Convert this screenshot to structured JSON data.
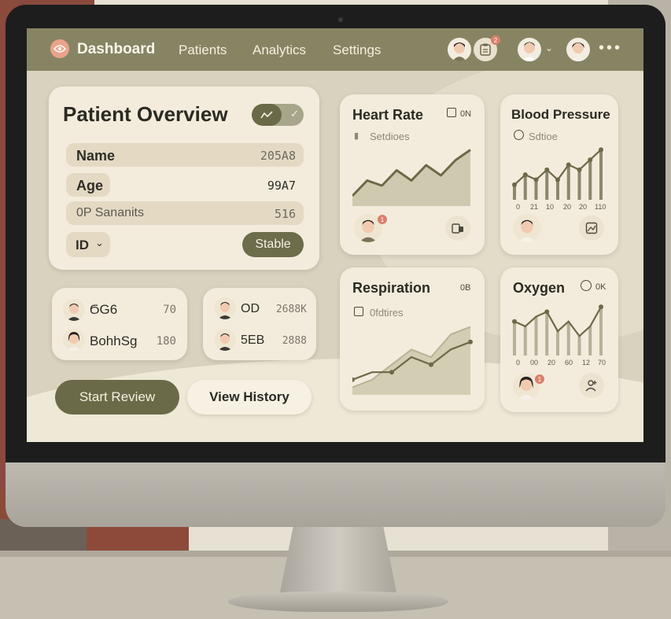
{
  "nav": {
    "brand": "Dashboard",
    "items": [
      "Patients",
      "Analytics",
      "Settings"
    ],
    "notif_count": "2"
  },
  "overview": {
    "title": "Patient Overview",
    "rows": [
      {
        "label": "Name",
        "value": "205A8"
      },
      {
        "label": "Age",
        "value": "99A7"
      },
      {
        "label": "0P Sananits",
        "value": "516"
      }
    ],
    "id_label": "ID",
    "status": "Stable"
  },
  "patients_left": [
    {
      "name": "ϬG6",
      "value": "70"
    },
    {
      "name": "BohhSg",
      "value": "180"
    }
  ],
  "patients_right": [
    {
      "name": "OD",
      "value": "2688K"
    },
    {
      "name": "5EB",
      "value": "2888"
    }
  ],
  "actions": {
    "start": "Start Review",
    "history": "View History"
  },
  "heart": {
    "title": "Heart Rate",
    "status": "0N",
    "subtitle": "Setdioes",
    "badge": "1"
  },
  "bp": {
    "title": "Blood Pressure",
    "subtitle": "Sdtioe",
    "ticks": [
      "0",
      "21",
      "10",
      "20",
      "20",
      "110"
    ]
  },
  "resp": {
    "title": "Respiration",
    "status": "0B",
    "subtitle": "0fdtires"
  },
  "oxygen": {
    "title": "Oxygen",
    "status": "0K",
    "badge": "1",
    "ticks": [
      "0",
      "00",
      "20",
      "60",
      "12",
      "70"
    ]
  },
  "colors": {
    "accent": "#6b6a48",
    "topbar": "#878464",
    "card": "#f3ecdc",
    "badge": "#d9816c"
  },
  "chart_data": [
    {
      "type": "area",
      "title": "Heart Rate",
      "x": [
        0,
        1,
        2,
        3,
        4,
        5,
        6,
        7,
        8
      ],
      "values": [
        2,
        5,
        4,
        7,
        5,
        8,
        6,
        9,
        11
      ],
      "ylim": [
        0,
        12
      ]
    },
    {
      "type": "bar",
      "title": "Blood Pressure",
      "categories": [
        "0",
        "21",
        "10",
        "20",
        "20",
        "110"
      ],
      "values": [
        3,
        5,
        4,
        6,
        4,
        7,
        6,
        8,
        10
      ]
    },
    {
      "type": "area",
      "title": "Respiration",
      "x": [
        0,
        1,
        2,
        3,
        4,
        5,
        6
      ],
      "series": [
        {
          "values": [
            2,
            3,
            3,
            5,
            4,
            6,
            7
          ]
        },
        {
          "values": [
            1,
            2,
            4,
            6,
            5,
            8,
            9
          ]
        }
      ],
      "ylim": [
        0,
        10
      ]
    },
    {
      "type": "bar",
      "title": "Oxygen",
      "categories": [
        "0",
        "00",
        "20",
        "60",
        "12",
        "70"
      ],
      "values": [
        7,
        6,
        8,
        9,
        5,
        7,
        4,
        6,
        10
      ]
    }
  ]
}
